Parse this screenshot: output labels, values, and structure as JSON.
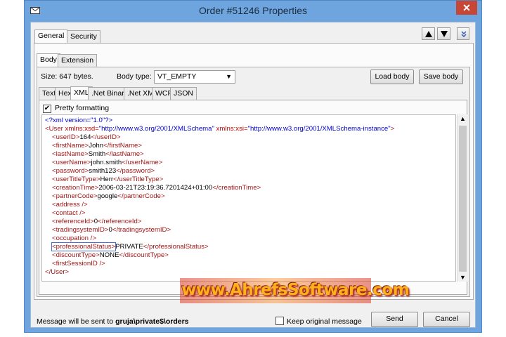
{
  "window": {
    "title": "Order #51246 Properties",
    "close_label": "✕"
  },
  "top_tabs": [
    {
      "label": "General",
      "active": true
    },
    {
      "label": "Security",
      "active": false
    }
  ],
  "body_tabs": [
    {
      "label": "Body",
      "active": true
    },
    {
      "label": "Extension",
      "active": false
    }
  ],
  "body": {
    "size_text": "Size: 647 bytes.",
    "body_type_label": "Body type:",
    "body_type_value": "VT_EMPTY",
    "load_button": "Load body",
    "save_button": "Save body"
  },
  "format_tabs": [
    {
      "label": "Text",
      "active": false
    },
    {
      "label": "Hex",
      "active": false
    },
    {
      "label": "XML",
      "active": true
    },
    {
      "label": ".Net Binary",
      "active": false
    },
    {
      "label": ".Net XML",
      "active": false
    },
    {
      "label": "WCF",
      "active": false
    },
    {
      "label": "JSON",
      "active": false
    }
  ],
  "pretty_formatting": {
    "label": "Pretty formatting",
    "checked": true
  },
  "xml": {
    "decl": "<?xml version=\"1.0\"?>",
    "user_open_a": "<User ",
    "user_attr1": "xmlns:xsd=",
    "user_val1": "\"http://www.w3.org/2001/XMLSchema\"",
    "user_attr2": " xmlns:xsi=",
    "user_val2": "\"http://www.w3.org/2001/XMLSchema-instance\"",
    "user_open_b": ">",
    "lines": [
      {
        "open": "<userID>",
        "text": "164",
        "close": "</userID>"
      },
      {
        "open": "<firstName>",
        "text": "John",
        "close": "</firstName>"
      },
      {
        "open": "<lastName>",
        "text": "Smith",
        "close": "</lastName>"
      },
      {
        "open": "<userName>",
        "text": "john.smith",
        "close": "</userName>"
      },
      {
        "open": "<password>",
        "text": "smith123",
        "close": "</password>"
      },
      {
        "open": "<userTitleType>",
        "text": "Herr",
        "close": "</userTitleType>"
      },
      {
        "open": "<creationTime>",
        "text": "2006-03-21T23:19:36.7201424+01:00",
        "close": "</creationTime>"
      },
      {
        "open": "<partnerCode>",
        "text": "google",
        "close": "</partnerCode>"
      },
      {
        "open": "<address />",
        "text": "",
        "close": ""
      },
      {
        "open": "<contact />",
        "text": "",
        "close": ""
      },
      {
        "open": "<referenceId>",
        "text": "0",
        "close": "</referenceId>"
      },
      {
        "open": "<tradingsystemID>",
        "text": "0",
        "close": "</tradingsystemID>"
      },
      {
        "open": "<occupation />",
        "text": "",
        "close": ""
      },
      {
        "open": "<professionalStatus>",
        "text": "PRIVATE",
        "close": "</professionalStatus>"
      },
      {
        "open": "<discountType>",
        "text": "NONE",
        "close": "</discountType>"
      },
      {
        "open": "<firstSessionID />",
        "text": "",
        "close": ""
      }
    ],
    "user_close": "</User>"
  },
  "status": {
    "prefix": "Message will be sent to ",
    "queue": "gruja\\private$\\orders"
  },
  "keep_original": {
    "label": "Keep original message",
    "checked": false
  },
  "send_button": "Send",
  "cancel_button": "Cancel",
  "watermark": "www.AhrefsSoftware.com",
  "icons": {
    "app": "envelope-icon",
    "up": "arrow-up-icon",
    "down": "arrow-down-icon",
    "collapse": "double-chevron-down-icon"
  }
}
